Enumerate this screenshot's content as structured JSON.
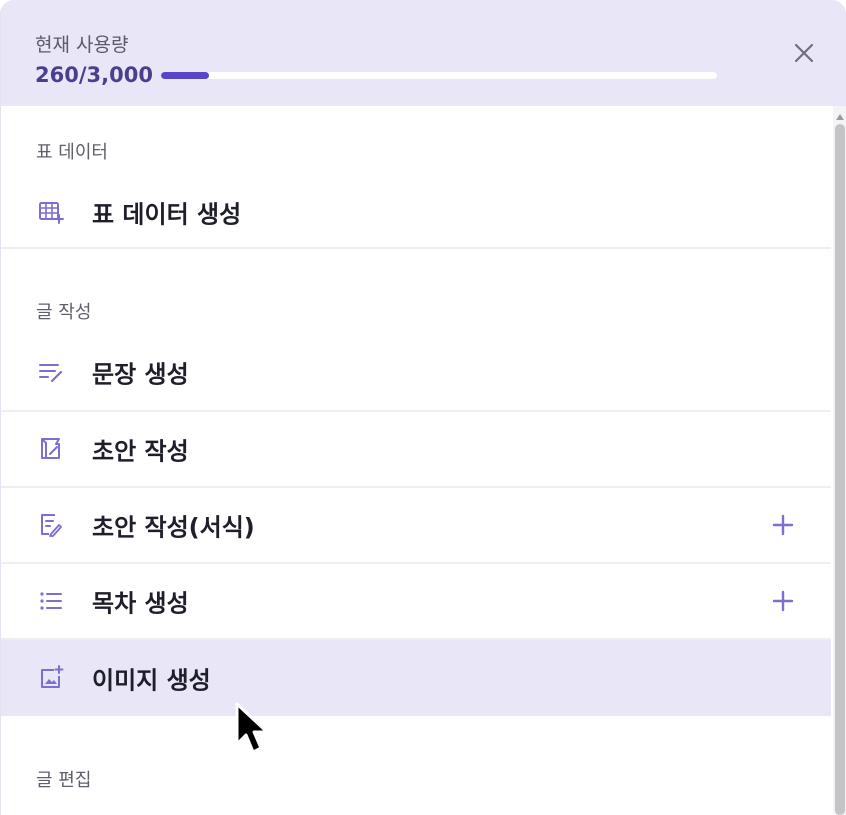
{
  "header": {
    "usage_label": "현재 사용량",
    "usage_value": "260/3,000",
    "usage_used": 260,
    "usage_total": 3000,
    "close_icon": "close-icon"
  },
  "colors": {
    "accent": "#5a45c8",
    "header_bg": "#e8e6f7",
    "icon": "#7b6fd0"
  },
  "sections": [
    {
      "label": "표 데이터",
      "items": [
        {
          "label": "표 데이터 생성",
          "icon": "table-add-icon"
        }
      ]
    },
    {
      "label": "글 작성",
      "items": [
        {
          "label": "문장 생성",
          "icon": "text-pen-icon"
        },
        {
          "label": "초안 작성",
          "icon": "draft-icon"
        },
        {
          "label": "초안 작성(서식)",
          "icon": "document-edit-icon",
          "expandable": true
        },
        {
          "label": "목차 생성",
          "icon": "list-icon",
          "expandable": true
        },
        {
          "label": "이미지 생성",
          "icon": "image-add-icon",
          "active": true
        }
      ]
    },
    {
      "label": "글 편집",
      "items": []
    }
  ]
}
